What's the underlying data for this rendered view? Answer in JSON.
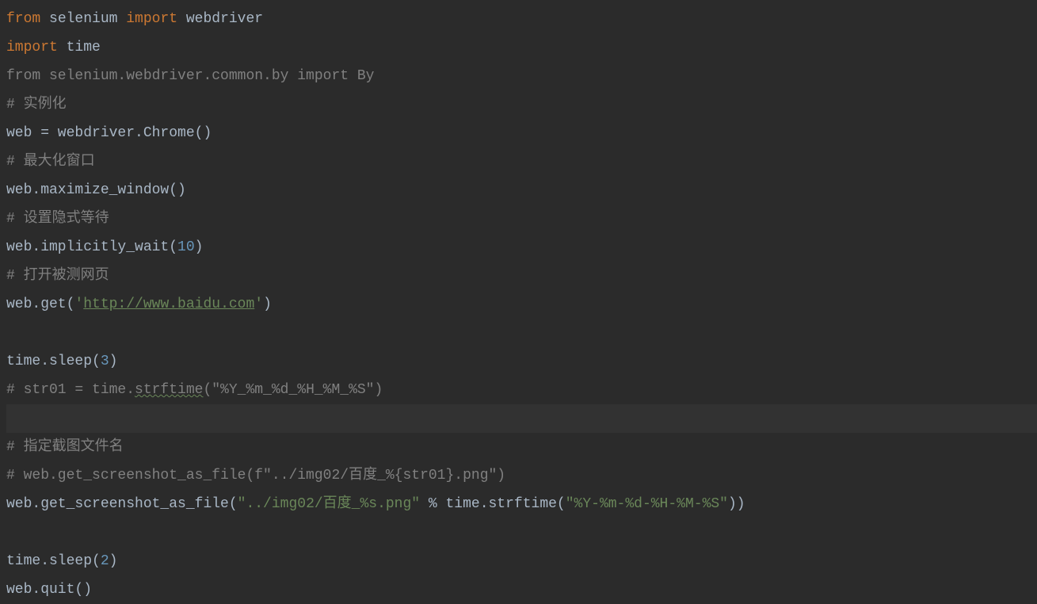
{
  "lines": [
    {
      "hl": false,
      "tokens": [
        {
          "t": "from ",
          "c": "kw"
        },
        {
          "t": "selenium ",
          "c": "ident"
        },
        {
          "t": "import ",
          "c": "kw"
        },
        {
          "t": "webdriver",
          "c": "ident"
        }
      ]
    },
    {
      "hl": false,
      "tokens": [
        {
          "t": "import ",
          "c": "kw"
        },
        {
          "t": "time",
          "c": "ident"
        }
      ]
    },
    {
      "hl": false,
      "tokens": [
        {
          "t": "from selenium.webdriver.common.by import By",
          "c": "comment"
        }
      ]
    },
    {
      "hl": false,
      "tokens": [
        {
          "t": "# 实例化",
          "c": "comment"
        }
      ]
    },
    {
      "hl": false,
      "tokens": [
        {
          "t": "web = webdriver.Chrome()",
          "c": "ident"
        }
      ]
    },
    {
      "hl": false,
      "tokens": [
        {
          "t": "# 最大化窗口",
          "c": "comment"
        }
      ]
    },
    {
      "hl": false,
      "tokens": [
        {
          "t": "web.maximize_window()",
          "c": "ident"
        }
      ]
    },
    {
      "hl": false,
      "tokens": [
        {
          "t": "# 设置隐式等待",
          "c": "comment"
        }
      ]
    },
    {
      "hl": false,
      "tokens": [
        {
          "t": "web.implicitly_wait(",
          "c": "ident"
        },
        {
          "t": "10",
          "c": "num"
        },
        {
          "t": ")",
          "c": "ident"
        }
      ]
    },
    {
      "hl": false,
      "tokens": [
        {
          "t": "# 打开被测网页",
          "c": "comment"
        }
      ]
    },
    {
      "hl": false,
      "tokens": [
        {
          "t": "web.get(",
          "c": "ident"
        },
        {
          "t": "'",
          "c": "str"
        },
        {
          "t": "http://www.baidu.com",
          "c": "url"
        },
        {
          "t": "'",
          "c": "str"
        },
        {
          "t": ")",
          "c": "ident"
        }
      ]
    },
    {
      "hl": false,
      "tokens": [
        {
          "t": " ",
          "c": "ident"
        }
      ]
    },
    {
      "hl": false,
      "tokens": [
        {
          "t": "time.sleep(",
          "c": "ident"
        },
        {
          "t": "3",
          "c": "num"
        },
        {
          "t": ")",
          "c": "ident"
        }
      ]
    },
    {
      "hl": false,
      "tokens": [
        {
          "t": "# str01 = time.",
          "c": "comment"
        },
        {
          "t": "strftime",
          "c": "comment wavy"
        },
        {
          "t": "(\"%Y_%m_%d_%H_%M_%S\")",
          "c": "comment"
        }
      ]
    },
    {
      "hl": true,
      "tokens": [
        {
          "t": " ",
          "c": "ident"
        }
      ]
    },
    {
      "hl": false,
      "tokens": [
        {
          "t": "# 指定截图文件名",
          "c": "comment"
        }
      ]
    },
    {
      "hl": false,
      "tokens": [
        {
          "t": "# web.get_screenshot_as_file(f\"../img02/百度_%{str01}.png\")",
          "c": "comment"
        }
      ]
    },
    {
      "hl": false,
      "tokens": [
        {
          "t": "web.get_screenshot_as_file(",
          "c": "ident"
        },
        {
          "t": "\"../img02/百度_%s.png\"",
          "c": "str"
        },
        {
          "t": " % time.strftime(",
          "c": "ident"
        },
        {
          "t": "\"%Y-%m-%d-%H-%M-%S\"",
          "c": "str"
        },
        {
          "t": "))",
          "c": "ident"
        }
      ]
    },
    {
      "hl": false,
      "tokens": [
        {
          "t": " ",
          "c": "ident"
        }
      ]
    },
    {
      "hl": false,
      "tokens": [
        {
          "t": "time.sleep(",
          "c": "ident"
        },
        {
          "t": "2",
          "c": "num"
        },
        {
          "t": ")",
          "c": "ident"
        }
      ]
    },
    {
      "hl": false,
      "tokens": [
        {
          "t": "web.quit()",
          "c": "ident"
        }
      ]
    }
  ]
}
